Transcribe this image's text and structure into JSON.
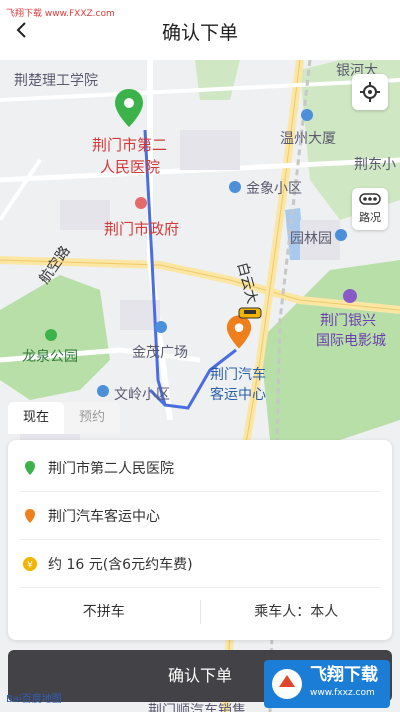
{
  "watermark_top": "飞翔下载 www.FXXZ.com",
  "header": {
    "title": "确认下单"
  },
  "map": {
    "labels": {
      "school": "荆楚理工学院",
      "hospital_line1": "荆门市第二",
      "hospital_line2": "人民医院",
      "gov": "荆门市政府",
      "jinxiang": "金象小区",
      "wenzhou": "温州大厦",
      "yinhe": "银河大",
      "jingdong": "荆东小",
      "yuanlin": "园林园",
      "hangkong": "航空路",
      "baiyun": "白云大",
      "longquan": "龙泉公园",
      "jinmao": "金茂广场",
      "wenling": "文岭小区",
      "cinema_line1": "荆门银兴",
      "cinema_line2": "国际电影城",
      "station_line1": "荆门汽车",
      "station_line2": "客运中心",
      "bottom_road": "荆门顺汽车销售"
    },
    "traffic_label": "路况"
  },
  "mode_tabs": [
    "现在",
    "预约"
  ],
  "order": {
    "origin": "荆门市第二人民医院",
    "destination": "荆门汽车客运中心",
    "fare": "约 16 元(含6元约车费)",
    "carpool": "不拼车",
    "passenger": "乘车人：本人"
  },
  "confirm_label": "确认下单",
  "baidu_logo": "Bai百度地图",
  "watermark_logo": {
    "title": "飞翔下载",
    "url": "www.fxxz.com"
  },
  "colors": {
    "route": "#4a6ee0",
    "origin_pin": "#3bb34a",
    "dest_pin": "#ee7f1a",
    "button": "#434246",
    "park": "#b9dfa8",
    "road": "#fbe6a4"
  }
}
